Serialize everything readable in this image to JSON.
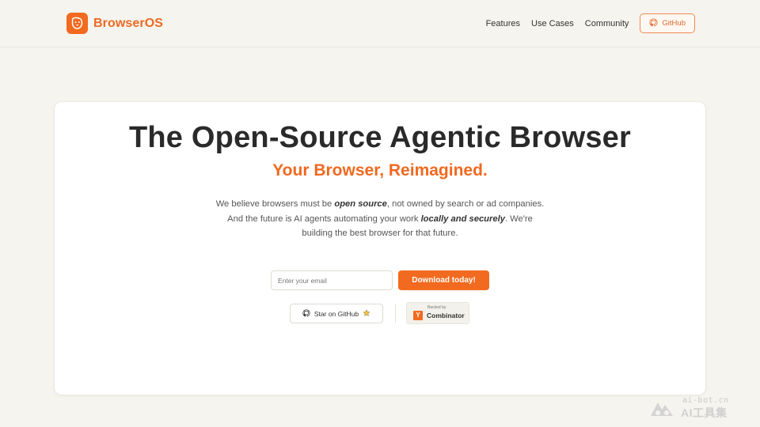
{
  "header": {
    "brand": "BrowserOS",
    "nav": [
      {
        "label": "Features"
      },
      {
        "label": "Use Cases"
      },
      {
        "label": "Community"
      }
    ],
    "github_label": "GitHub"
  },
  "hero": {
    "title": "The Open-Source Agentic Browser",
    "subtitle": "Your Browser, Reimagined.",
    "desc_parts": {
      "p1": "We believe browsers must be ",
      "em1": "open source",
      "p2": ", not owned by search or ad companies. And the future is AI agents automating your work ",
      "em2": "locally and securely",
      "p3": ". We're building the best browser for that future."
    }
  },
  "signup": {
    "email_placeholder": "Enter your email",
    "download_label": "Download today!"
  },
  "social": {
    "star_label": "Star on GitHub",
    "yc_backed": "Backed by",
    "yc_letter": "Y",
    "yc_name": "Combinator"
  },
  "watermark": {
    "url": "ai-bot.cn",
    "name": "AI工具集"
  },
  "colors": {
    "accent": "#f26a1f",
    "background": "#f6f4ee",
    "card": "#ffffff"
  },
  "icons": {
    "logo": "dog-head-icon",
    "github": "github-icon",
    "star": "star-icon"
  }
}
